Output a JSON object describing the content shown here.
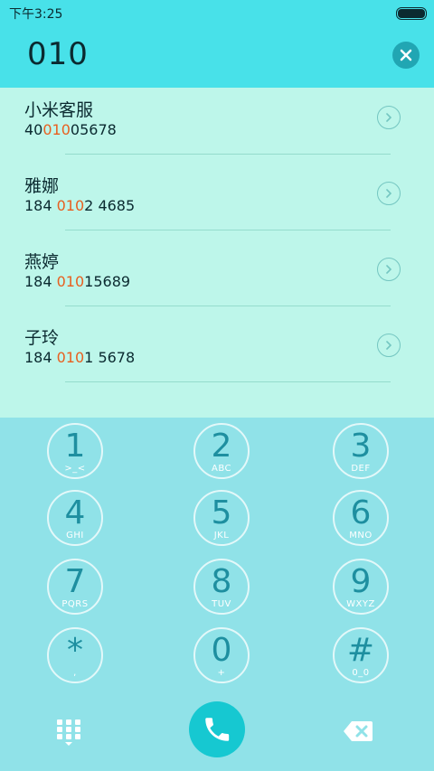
{
  "status_bar": {
    "time": "下午3:25"
  },
  "dialer": {
    "input_value": "010"
  },
  "results": [
    {
      "name": "小米客服",
      "number_pre": "40",
      "number_match": "010",
      "number_post": "05678"
    },
    {
      "name": "雅娜",
      "number_pre": "184 ",
      "number_match": "010",
      "number_post": "2 4685"
    },
    {
      "name": "燕婷",
      "number_pre": "184 ",
      "number_match": "010",
      "number_post": "15689"
    },
    {
      "name": "子玲",
      "number_pre": "184 ",
      "number_match": "010",
      "number_post": "1 5678"
    }
  ],
  "keypad": [
    {
      "digit": "1",
      "letters": ">_<"
    },
    {
      "digit": "2",
      "letters": "ABC"
    },
    {
      "digit": "3",
      "letters": "DEF"
    },
    {
      "digit": "4",
      "letters": "GHI"
    },
    {
      "digit": "5",
      "letters": "JKL"
    },
    {
      "digit": "6",
      "letters": "MNO"
    },
    {
      "digit": "7",
      "letters": "PQRS"
    },
    {
      "digit": "8",
      "letters": "TUV"
    },
    {
      "digit": "9",
      "letters": "WXYZ"
    },
    {
      "digit": "*",
      "letters": ","
    },
    {
      "digit": "0",
      "letters": "+"
    },
    {
      "digit": "#",
      "letters": "0_0"
    }
  ],
  "icons": {
    "clear": "close-icon",
    "detail": "chevron-right-icon",
    "keypad_toggle": "dialpad-icon",
    "call": "phone-icon",
    "backspace": "backspace-icon"
  },
  "colors": {
    "header": "#48e1e9",
    "results_bg": "#bdf6ea",
    "keypad_bg": "#90e2e8",
    "highlight": "#e85f1f",
    "call_button": "#16c8d1"
  }
}
